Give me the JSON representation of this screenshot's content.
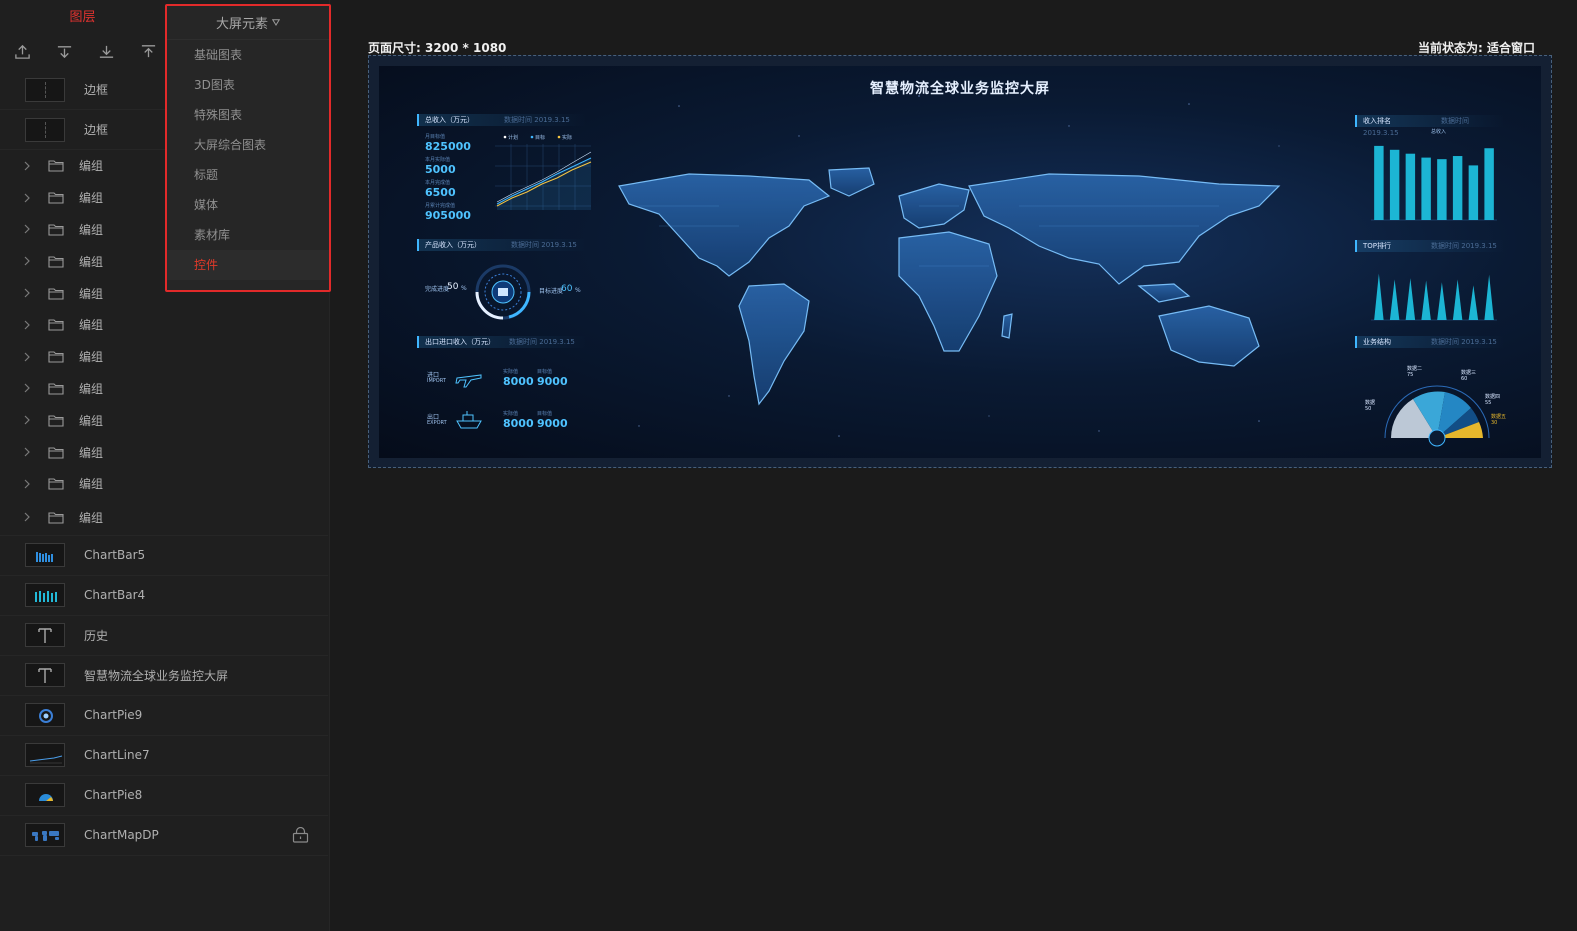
{
  "left_panel": {
    "title": "图层",
    "toolbar": [
      "move-top-icon",
      "align-center-icon",
      "move-bottom-icon",
      "move-up-icon"
    ],
    "layers": [
      {
        "type": "frame",
        "label": "边框"
      },
      {
        "type": "frame",
        "label": "边框"
      },
      {
        "type": "group",
        "label": "编组"
      },
      {
        "type": "group",
        "label": "编组"
      },
      {
        "type": "group",
        "label": "编组"
      },
      {
        "type": "group",
        "label": "编组"
      },
      {
        "type": "group",
        "label": "编组"
      },
      {
        "type": "group",
        "label": "编组"
      },
      {
        "type": "group",
        "label": "编组"
      },
      {
        "type": "group",
        "label": "编组"
      },
      {
        "type": "group",
        "label": "编组"
      },
      {
        "type": "group",
        "label": "编组"
      },
      {
        "type": "group",
        "label": "编组"
      },
      {
        "type": "group",
        "label": "编组"
      },
      {
        "type": "chart",
        "label": "ChartBar5"
      },
      {
        "type": "chart",
        "label": "ChartBar4"
      },
      {
        "type": "text",
        "label": "历史"
      },
      {
        "type": "text",
        "label": "智慧物流全球业务监控大屏"
      },
      {
        "type": "chart",
        "label": "ChartPie9"
      },
      {
        "type": "chart",
        "label": "ChartLine7"
      },
      {
        "type": "chart",
        "label": "ChartPie8"
      },
      {
        "type": "chart",
        "label": "ChartMapDP",
        "locked": true
      }
    ]
  },
  "dropdown": {
    "title": "大屏元素",
    "items": [
      "基础图表",
      "3D图表",
      "特殊图表",
      "大屏综合图表",
      "标题",
      "媒体",
      "素材库",
      "控件"
    ],
    "active": "控件",
    "accent": "#e22a2a"
  },
  "canvas": {
    "page_size": "页面尺寸: 3200 * 1080",
    "status": "当前状态为: 适合窗口"
  },
  "dashboard": {
    "title": "智慧物流全球业务监控大屏",
    "date": "2019.3.15",
    "date_prefix": "数据时间",
    "panels": {
      "total_income": {
        "title": "总收入（万元）",
        "stats": [
          {
            "label": "月目标值",
            "value": "825000"
          },
          {
            "label": "本月实际值",
            "value": "5000"
          },
          {
            "label": "本月完成值",
            "value": "6500"
          },
          {
            "label": "月累计完成值",
            "value": "905000"
          }
        ],
        "legend": [
          "计划",
          "目标",
          "实际"
        ]
      },
      "product_income": {
        "title": "产品收入（万元）",
        "left_label": "完成进度",
        "left_value": "50",
        "right_label": "目标进度",
        "right_value": "60",
        "unit": "%"
      },
      "import_export": {
        "title": "出口进口收入（万元）",
        "import_label": "进口",
        "import_en": "IMPORT",
        "export_label": "出口",
        "export_en": "EXPORT",
        "col1": "实际值",
        "col2": "目标值",
        "import_values": [
          "8000",
          "9000"
        ],
        "export_values": [
          "8000",
          "9000"
        ]
      },
      "income_rank": {
        "title": "收入排名",
        "legend": "总收入",
        "values": [
          95,
          90,
          85,
          80,
          78,
          82,
          70,
          92
        ]
      },
      "top_rank": {
        "title": "TOP排行",
        "values": [
          80,
          70,
          72,
          68,
          65,
          70,
          60,
          78
        ]
      },
      "business": {
        "title": "业务结构",
        "labels": [
          "数据",
          "数据二",
          "数据三",
          "数据四",
          "数据五"
        ],
        "values": [
          "50",
          "75",
          "60",
          "55",
          "30"
        ]
      }
    },
    "colors": {
      "accent": "#3fb6ff",
      "bar": "#1ec6e6",
      "line_gold": "#f5c542"
    }
  }
}
